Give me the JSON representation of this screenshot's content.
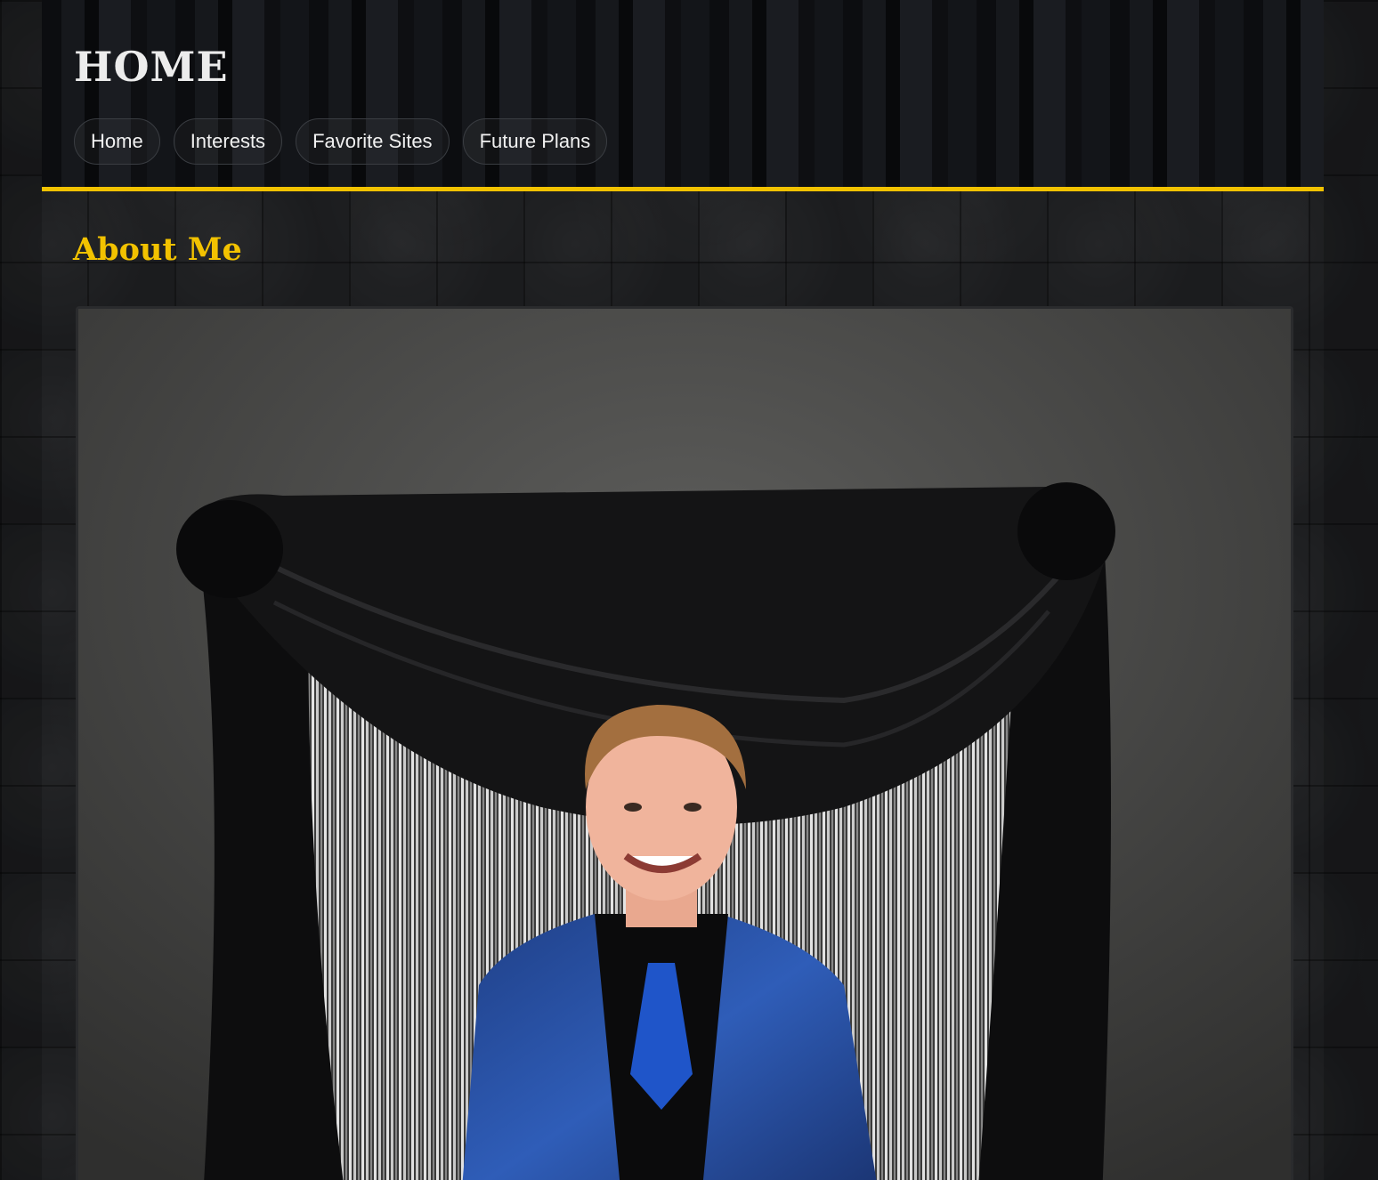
{
  "header": {
    "title": "HOME",
    "nav": [
      {
        "label": "Home"
      },
      {
        "label": "Interests"
      },
      {
        "label": "Favorite Sites"
      },
      {
        "label": "Future Plans"
      }
    ],
    "accent_color": "#f2c200"
  },
  "main": {
    "section_title": "About Me",
    "photo": {
      "alt": "Portrait photo"
    }
  }
}
